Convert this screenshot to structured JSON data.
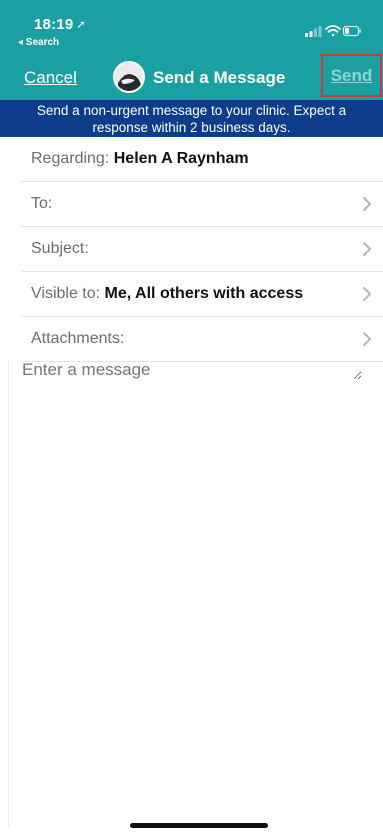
{
  "status": {
    "time": "18:19",
    "location_arrow": "➚",
    "back_label": "◂ Search"
  },
  "nav": {
    "cancel_label": "Cancel",
    "title": "Send a Message",
    "send_label": "Send"
  },
  "notice": {
    "text": "Send a non-urgent message to your clinic. Expect a response within 2 business days."
  },
  "form": {
    "regarding_label": "Regarding:",
    "regarding_value": "Helen A Raynham",
    "to_label": "To:",
    "subject_label": "Subject:",
    "visible_label": "Visible to:",
    "visible_value": "Me, All others with access",
    "attachments_label": "Attachments:"
  },
  "message": {
    "placeholder": "Enter a message"
  },
  "colors": {
    "header": "#1aa0a3",
    "notice": "#0d3c8b",
    "highlight": "#d23737"
  }
}
